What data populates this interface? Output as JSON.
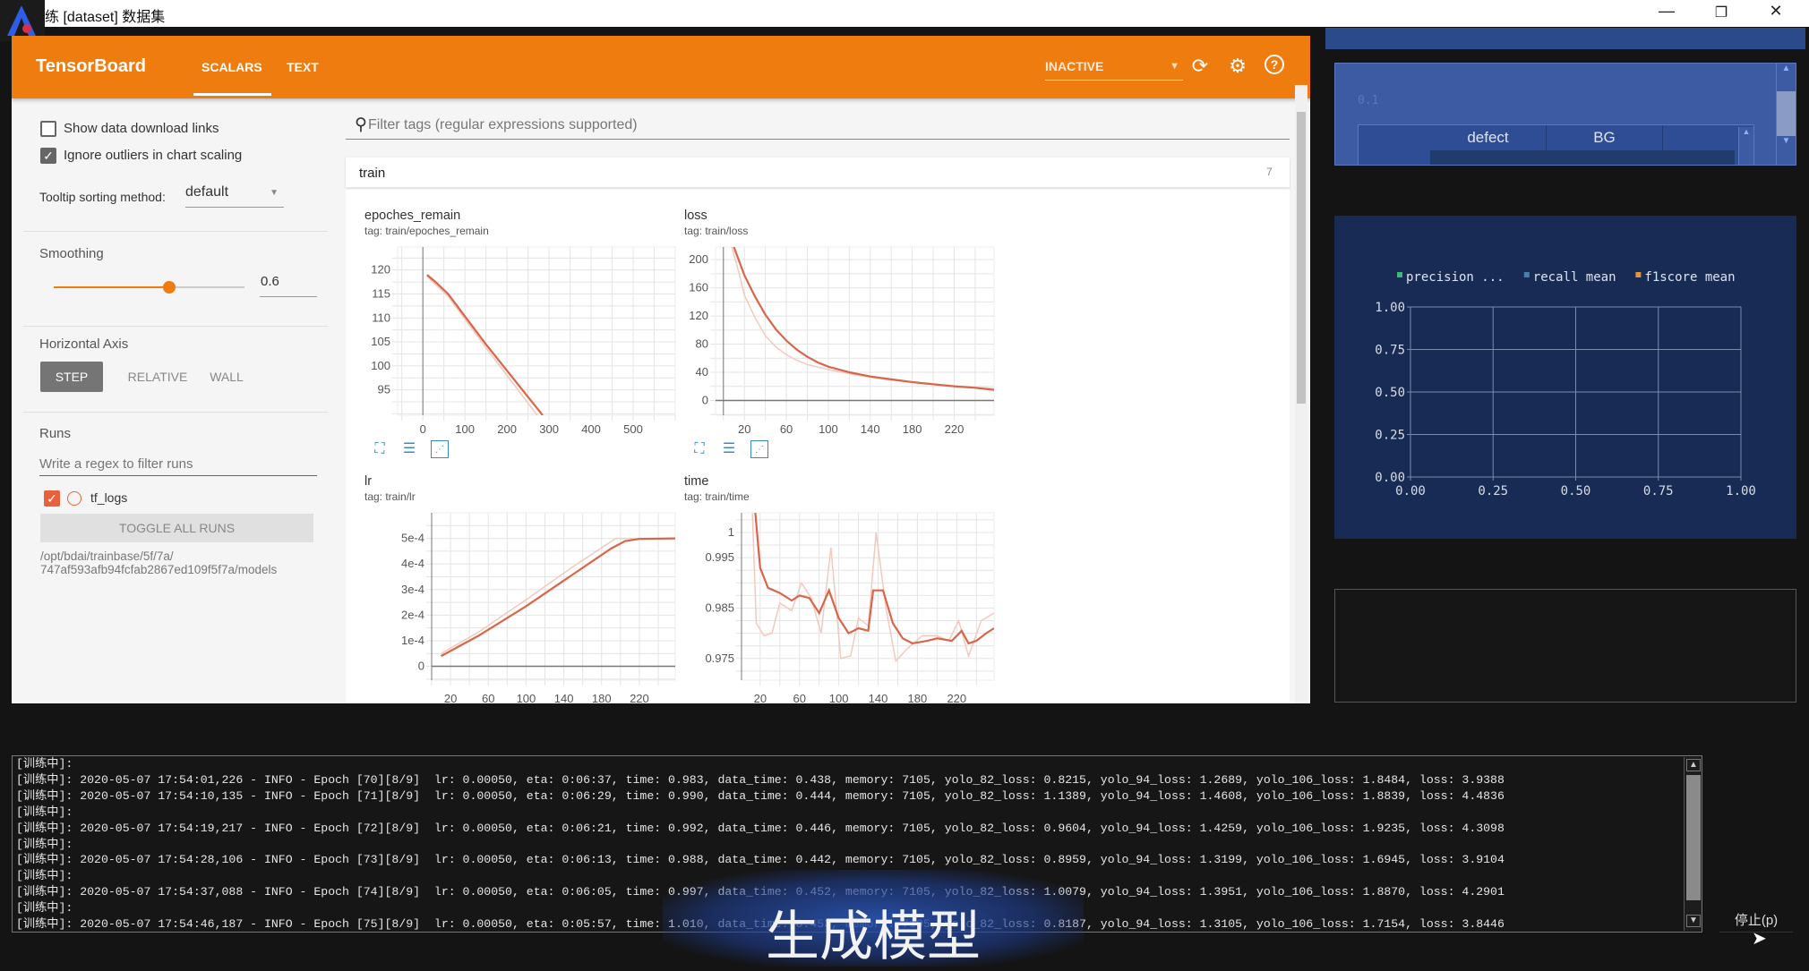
{
  "window": {
    "title": "练 [dataset] 数据集",
    "controls": [
      "minimize-icon",
      "restore-icon",
      "close-icon"
    ]
  },
  "header": {
    "brand": "TensorBoard",
    "tabs": [
      {
        "label": "SCALARS",
        "active": true
      },
      {
        "label": "TEXT",
        "active": false
      }
    ],
    "status_select": "INACTIVE",
    "accent": "#ef7c0e",
    "icons": [
      "refresh-icon",
      "gear-icon",
      "help-icon"
    ]
  },
  "sidebar": {
    "show_download": {
      "label": "Show data download links",
      "checked": false
    },
    "ignore_outliers": {
      "label": "Ignore outliers in chart scaling",
      "checked": true
    },
    "tooltip": {
      "label": "Tooltip sorting method:",
      "value": "default"
    },
    "smoothing": {
      "label": "Smoothing",
      "value": "0.6",
      "fraction": 0.6
    },
    "horizontal_axis": {
      "label": "Horizontal Axis",
      "options": [
        "STEP",
        "RELATIVE",
        "WALL"
      ],
      "selected": "STEP"
    },
    "runs": {
      "label": "Runs",
      "filter_placeholder": "Write a regex to filter runs",
      "items": [
        {
          "name": "tf_logs",
          "checked": true,
          "color": "#e8613c"
        }
      ],
      "toggle_all": "TOGGLE ALL RUNS",
      "path_line1": "/opt/bdai/trainbase/5f/7a/",
      "path_line2": "747af593afb94fcfab2867ed109f5f7a/models"
    }
  },
  "main": {
    "filter_placeholder": "Filter tags (regular expressions supported)",
    "group": {
      "name": "train",
      "count": "7"
    }
  },
  "chart_data": [
    {
      "type": "line",
      "title": "epoches_remain",
      "tag": "tag: train/epoches_remain",
      "xlim": [
        -60,
        600
      ],
      "ylim": [
        89.7,
        124.8
      ],
      "xticks": [
        "0",
        "100",
        "200",
        "300",
        "400",
        "500"
      ],
      "yticks": [
        "95",
        "100",
        "105",
        "110",
        "115",
        "120"
      ],
      "series": [
        {
          "values": [
            [
              10,
              119
            ],
            [
              30,
              117.5
            ],
            [
              60,
              115
            ],
            [
              150,
              104.5
            ],
            [
              285,
              89.7
            ]
          ]
        },
        {
          "values": [
            [
              10,
              118.7
            ],
            [
              30,
              117
            ],
            [
              60,
              114.5
            ],
            [
              150,
              103.8
            ],
            [
              272,
              89.7
            ]
          ]
        }
      ]
    },
    {
      "type": "line",
      "title": "loss",
      "tag": "tag: train/loss",
      "xlim": [
        -7.5,
        258
      ],
      "ylim": [
        -21,
        218
      ],
      "xticks": [
        "20",
        "60",
        "100",
        "140",
        "180",
        "220"
      ],
      "yticks": [
        "0",
        "40",
        "80",
        "120",
        "160",
        "200"
      ],
      "series": [
        {
          "values": [
            [
              10,
              218
            ],
            [
              20,
              178
            ],
            [
              30,
              148
            ],
            [
              40,
              122
            ],
            [
              50,
              101
            ],
            [
              60,
              85
            ],
            [
              70,
              72
            ],
            [
              80,
              62
            ],
            [
              90,
              54
            ],
            [
              100,
              48
            ],
            [
              120,
              40
            ],
            [
              140,
              34
            ],
            [
              160,
              30
            ],
            [
              180,
              26
            ],
            [
              200,
              23
            ],
            [
              220,
              20
            ],
            [
              240,
              18
            ],
            [
              258,
              15
            ]
          ]
        },
        {
          "values": [
            [
              8,
              218
            ],
            [
              15,
              180
            ],
            [
              20,
              150
            ],
            [
              30,
              118
            ],
            [
              40,
              92
            ],
            [
              50,
              76
            ],
            [
              60,
              65
            ],
            [
              70,
              57
            ],
            [
              80,
              51
            ],
            [
              100,
              44
            ],
            [
              120,
              38
            ],
            [
              140,
              33
            ],
            [
              160,
              29
            ],
            [
              180,
              26
            ],
            [
              200,
              23
            ],
            [
              220,
              21
            ],
            [
              258,
              17
            ]
          ]
        }
      ]
    },
    {
      "type": "line",
      "title": "lr",
      "tag": "tag: train/lr",
      "xlim": [
        0,
        258
      ],
      "ylim": [
        -5.4e-05,
        0.0006
      ],
      "xticks": [
        "20",
        "60",
        "100",
        "140",
        "180",
        "220"
      ],
      "yticks": [
        "0",
        "1e-4",
        "2e-4",
        "3e-4",
        "4e-4",
        "5e-4"
      ],
      "series": [
        {
          "values": [
            [
              10,
              4e-05
            ],
            [
              50,
              0.00012
            ],
            [
              100,
              0.000235
            ],
            [
              150,
              0.00036
            ],
            [
              190,
              0.00046
            ],
            [
              205,
              0.00049
            ],
            [
              220,
              0.000498
            ],
            [
              258,
              0.0005
            ]
          ]
        },
        {
          "values": [
            [
              10,
              5e-05
            ],
            [
              50,
              0.000135
            ],
            [
              100,
              0.00026
            ],
            [
              150,
              0.00039
            ],
            [
              195,
              0.0005
            ],
            [
              258,
              0.0005
            ]
          ]
        }
      ]
    },
    {
      "type": "line",
      "title": "time",
      "tag": "tag: train/time",
      "xlim": [
        1,
        258
      ],
      "ylim": [
        0.9707,
        1.0039
      ],
      "xticks": [
        "20",
        "60",
        "100",
        "140",
        "180",
        "220"
      ],
      "yticks": [
        "0.975",
        "0.985",
        "0.995",
        "1"
      ],
      "series": [
        {
          "values": [
            [
              15,
              1.0039
            ],
            [
              20,
              0.993
            ],
            [
              28,
              0.989
            ],
            [
              40,
              0.988
            ],
            [
              52,
              0.9865
            ],
            [
              60,
              0.9875
            ],
            [
              70,
              0.987
            ],
            [
              80,
              0.984
            ],
            [
              90,
              0.9885
            ],
            [
              100,
              0.983
            ],
            [
              110,
              0.98
            ],
            [
              120,
              0.981
            ],
            [
              130,
              0.9805
            ],
            [
              135,
              0.9885
            ],
            [
              145,
              0.9885
            ],
            [
              155,
              0.982
            ],
            [
              165,
              0.979
            ],
            [
              175,
              0.978
            ],
            [
              190,
              0.9785
            ],
            [
              200,
              0.979
            ],
            [
              215,
              0.9785
            ],
            [
              225,
              0.9805
            ],
            [
              232,
              0.978
            ],
            [
              240,
              0.9785
            ],
            [
              250,
              0.98
            ],
            [
              258,
              0.981
            ]
          ]
        },
        {
          "values": [
            [
              12,
              1.0039
            ],
            [
              16,
              0.982
            ],
            [
              24,
              0.9795
            ],
            [
              32,
              0.98
            ],
            [
              40,
              0.986
            ],
            [
              52,
              0.9845
            ],
            [
              62,
              0.99
            ],
            [
              72,
              0.987
            ],
            [
              82,
              0.98
            ],
            [
              92,
              0.997
            ],
            [
              102,
              0.975
            ],
            [
              112,
              0.9755
            ],
            [
              120,
              0.983
            ],
            [
              130,
              0.9815
            ],
            [
              138,
              1.0
            ],
            [
              148,
              0.985
            ],
            [
              158,
              0.9745
            ],
            [
              170,
              0.977
            ],
            [
              185,
              0.9795
            ],
            [
              200,
              0.9795
            ],
            [
              212,
              0.9785
            ],
            [
              222,
              0.9825
            ],
            [
              232,
              0.9755
            ],
            [
              245,
              0.9825
            ],
            [
              258,
              0.984
            ]
          ]
        }
      ]
    },
    {
      "type": "line",
      "legend": [
        {
          "name": "precision ...",
          "color": "#3cb878"
        },
        {
          "name": "recall mean",
          "color": "#4a7fa8"
        },
        {
          "name": "f1score mean",
          "color": "#e8923a"
        }
      ],
      "legend_position": "top",
      "xlim": [
        0,
        1
      ],
      "ylim": [
        0,
        1
      ],
      "xticks": [
        "0.00",
        "0.25",
        "0.50",
        "0.75",
        "1.00"
      ],
      "yticks": [
        "0.00",
        "0.25",
        "0.50",
        "0.75",
        "1.00"
      ],
      "grid": true,
      "series": []
    }
  ],
  "right_panel": {
    "faint_value": "0.1",
    "table_headers": [
      "defect",
      "BG"
    ]
  },
  "log": {
    "lines": [
      "[训练中]:",
      "[训练中]: 2020-05-07 17:54:01,226 - INFO - Epoch [70][8/9]  lr: 0.00050, eta: 0:06:37, time: 0.983, data_time: 0.438, memory: 7105, yolo_82_loss: 0.8215, yolo_94_loss: 1.2689, yolo_106_loss: 1.8484, loss: 3.9388",
      "[训练中]: 2020-05-07 17:54:10,135 - INFO - Epoch [71][8/9]  lr: 0.00050, eta: 0:06:29, time: 0.990, data_time: 0.444, memory: 7105, yolo_82_loss: 1.1389, yolo_94_loss: 1.4608, yolo_106_loss: 1.8839, loss: 4.4836",
      "[训练中]:",
      "[训练中]: 2020-05-07 17:54:19,217 - INFO - Epoch [72][8/9]  lr: 0.00050, eta: 0:06:21, time: 0.992, data_time: 0.446, memory: 7105, yolo_82_loss: 0.9604, yolo_94_loss: 1.4259, yolo_106_loss: 1.9235, loss: 4.3098",
      "[训练中]:",
      "[训练中]: 2020-05-07 17:54:28,106 - INFO - Epoch [73][8/9]  lr: 0.00050, eta: 0:06:13, time: 0.988, data_time: 0.442, memory: 7105, yolo_82_loss: 0.8959, yolo_94_loss: 1.3199, yolo_106_loss: 1.6945, loss: 3.9104",
      "[训练中]:",
      "[训练中]: 2020-05-07 17:54:37,088 - INFO - Epoch [74][8/9]  lr: 0.00050, eta: 0:06:05, time: 0.997, data_time: 0.452, memory: 7105, yolo_82_loss: 1.0079, yolo_94_loss: 1.3951, yolo_106_loss: 1.8870, loss: 4.2901",
      "[训练中]:",
      "[训练中]: 2020-05-07 17:54:46,187 - INFO - Epoch [75][8/9]  lr: 0.00050, eta: 0:05:57, time: 1.010, data_time: 0.453, memory: 7105, yolo_82_loss: 0.8187, yolo_94_loss: 1.3105, yolo_106_loss: 1.7154, loss: 3.8446"
    ]
  },
  "stop_button": "停止(p)",
  "subtitle": "生成模型"
}
